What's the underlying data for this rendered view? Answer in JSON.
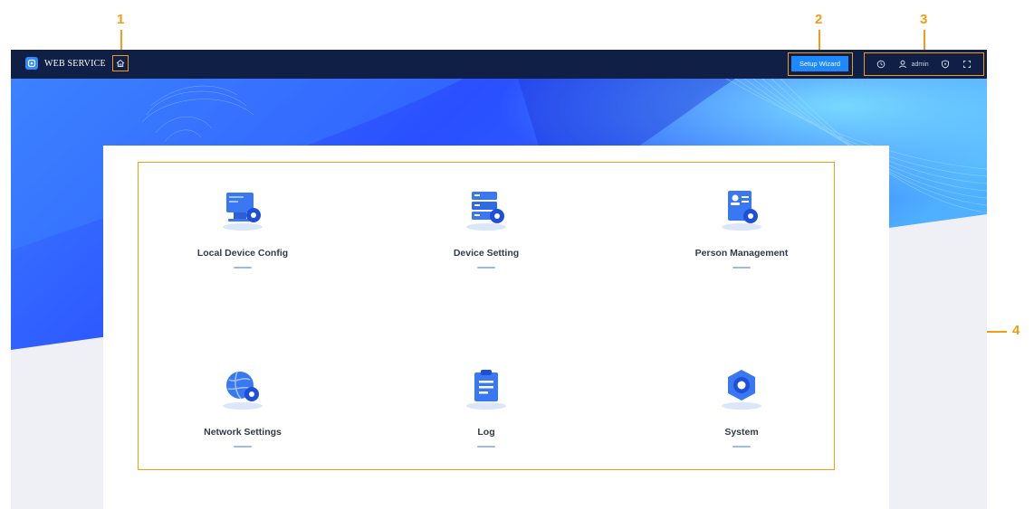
{
  "callouts": [
    "1",
    "2",
    "3",
    "4"
  ],
  "topbar": {
    "brand": "WEB SERVICE",
    "home_icon": "home-icon",
    "wizard_label": "Setup Wizard",
    "user_name": "admin",
    "icons": [
      "clock-icon",
      "user-icon",
      "shield-icon",
      "fullscreen-icon"
    ]
  },
  "tiles": [
    {
      "label": "Local Device Config",
      "icon": "monitor-gear-icon"
    },
    {
      "label": "Device Setting",
      "icon": "server-gear-icon"
    },
    {
      "label": "Person Management",
      "icon": "person-card-gear-icon"
    },
    {
      "label": "Network Settings",
      "icon": "globe-gear-icon"
    },
    {
      "label": "Log",
      "icon": "clipboard-icon"
    },
    {
      "label": "System",
      "icon": "hex-nut-icon"
    }
  ],
  "colors": {
    "topbar": "#0f1f45",
    "accent": "#1e88ff",
    "callout": "#f39c12",
    "banner_blue": "#2a4fff"
  }
}
